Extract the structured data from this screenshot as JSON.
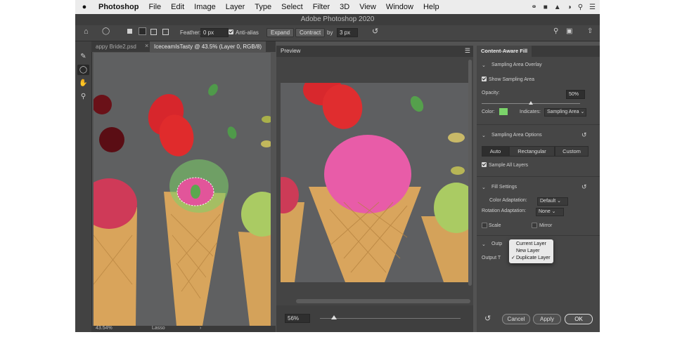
{
  "menubar": {
    "apple_icon": "apple-icon",
    "app_name": "Photoshop",
    "items": [
      "File",
      "Edit",
      "Image",
      "Layer",
      "Type",
      "Select",
      "Filter",
      "3D",
      "View",
      "Window",
      "Help"
    ]
  },
  "window": {
    "title": "Adobe Photoshop 2020"
  },
  "options_bar": {
    "feather_label": "Feather:",
    "feather_value": "0 px",
    "antialias_label": "Anti-alias",
    "expand_label": "Expand",
    "contract_label": "Contract",
    "by_label": "by",
    "by_value": "3 px"
  },
  "doc_tabs": [
    {
      "label": "appy Bride2.psd"
    },
    {
      "label": "IceceamIsTasty @ 43.5% (Layer 0, RGB/8)"
    }
  ],
  "doc_status": {
    "zoom": "43.54%",
    "tool": "Lasso"
  },
  "preview": {
    "title": "Preview",
    "zoom": "56%",
    "zoom_fraction": 0.1
  },
  "caf": {
    "tab_label": "Content-Aware Fill",
    "sampling_overlay": {
      "header": "Sampling Area Overlay",
      "show_label": "Show Sampling Area",
      "show_checked": true,
      "opacity_label": "Opacity:",
      "opacity_value": "50%",
      "opacity_fraction": 0.5,
      "color_label": "Color:",
      "color_hex": "#7bd46a",
      "indicates_label": "Indicates:",
      "indicates_value": "Sampling Area"
    },
    "sampling_options": {
      "header": "Sampling Area Options",
      "modes": [
        "Auto",
        "Rectangular",
        "Custom"
      ],
      "sample_all_label": "Sample All Layers",
      "sample_all_checked": true
    },
    "fill_settings": {
      "header": "Fill Settings",
      "color_adapt_label": "Color Adaptation:",
      "color_adapt_value": "Default",
      "rotation_label": "Rotation Adaptation:",
      "rotation_value": "None",
      "scale_label": "Scale",
      "mirror_label": "Mirror"
    },
    "output": {
      "header_partial": "Outp",
      "label_partial": "Output T",
      "menu": [
        "Current Layer",
        "New Layer",
        "Duplicate Layer"
      ],
      "selected": "Duplicate Layer"
    },
    "buttons": {
      "cancel": "Cancel",
      "apply": "Apply",
      "ok": "OK"
    }
  },
  "colors": {
    "panel": "#535353",
    "dark": "#3a3a3a",
    "menubar": "#ececec",
    "sampling_overlay": "#7bd46a"
  }
}
